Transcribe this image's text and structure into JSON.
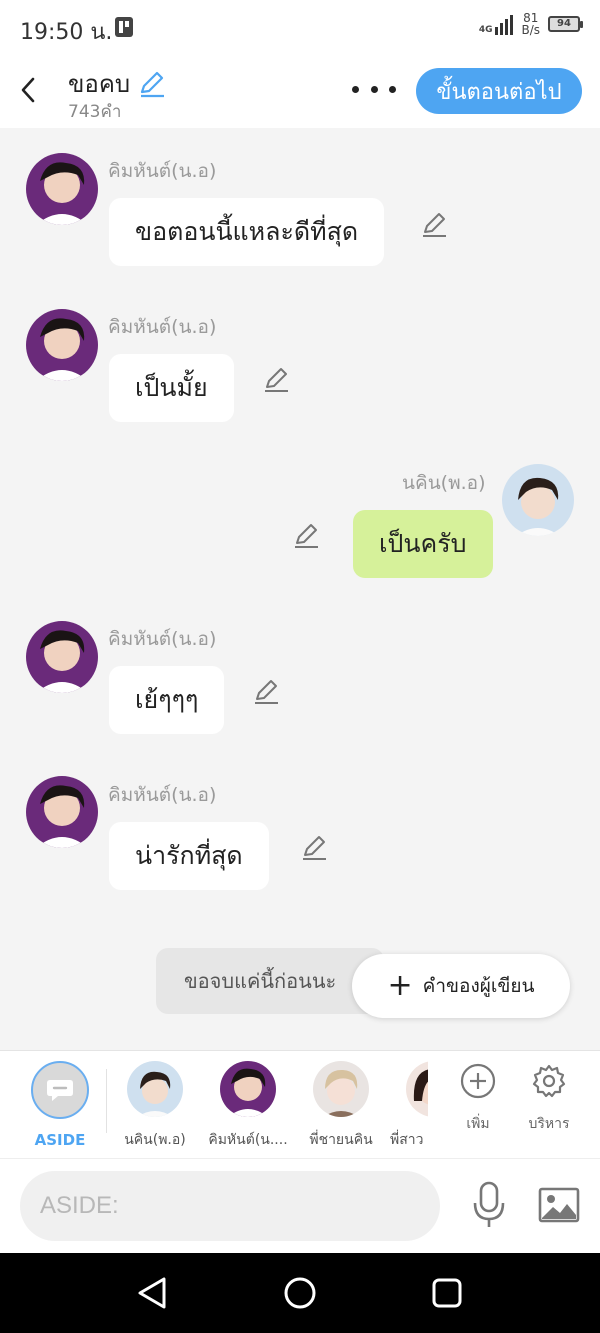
{
  "status": {
    "time": "19:50 น.",
    "network": "4G",
    "speed_value": "81",
    "speed_unit": "B/s",
    "battery": "94"
  },
  "header": {
    "title": "ขอคบ",
    "word_count": "743คำ",
    "next_label": "ขั้นตอนต่อไป"
  },
  "messages": [
    {
      "sender": "คิมหันต์(น.อ)",
      "text": "ขอตอนนี้แหละดีที่สุด",
      "side": "left"
    },
    {
      "sender": "คิมหันต์(น.อ)",
      "text": "เป็นมั้ย",
      "side": "left"
    },
    {
      "sender": "นคิน(พ.อ)",
      "text": "เป็นครับ",
      "side": "right"
    },
    {
      "sender": "คิมหันต์(น.อ)",
      "text": "เย้ๆๆๆ",
      "side": "left"
    },
    {
      "sender": "คิมหันต์(น.อ)",
      "text": "น่ารักที่สุด",
      "side": "left"
    }
  ],
  "aside_message": "ขอจบแค่นี้ก่อนนะ",
  "author_button": "คำของผู้เขียน",
  "characters": {
    "aside": "ASIDE",
    "list": [
      "นคิน(พ.อ)",
      "คิมหันต์(น....",
      "พี่ชายนคิน",
      "พี่สาว"
    ],
    "add_label": "เพิ่ม",
    "manage_label": "บริหาร"
  },
  "input": {
    "placeholder": "ASIDE:"
  },
  "colors": {
    "accent": "#4ea5f2",
    "right_bubble": "#d6f19a",
    "left_bubble": "#ffffff"
  }
}
